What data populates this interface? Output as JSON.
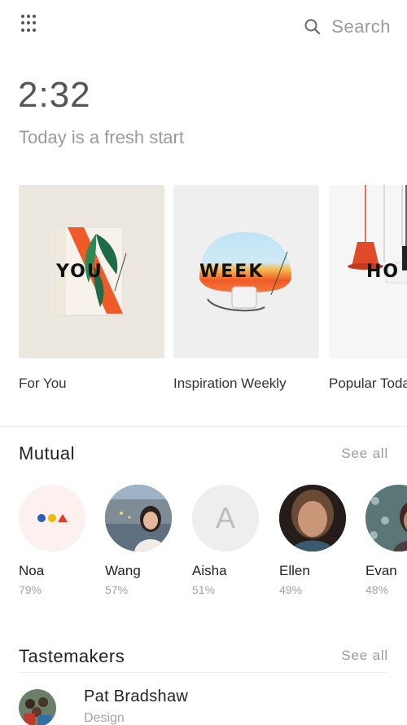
{
  "header": {
    "menu_icon": "grid-menu-icon",
    "search_icon": "search-icon",
    "search_label": "Search"
  },
  "hero": {
    "time": "2:32",
    "greeting": "Today is a fresh start"
  },
  "collections": [
    {
      "label": "For You",
      "thumb_word": "YOU",
      "bg": "#ece8df"
    },
    {
      "label": "Inspiration Weekly",
      "thumb_word": "WEEK",
      "bg": "#efefef"
    },
    {
      "label": "Popular Today",
      "thumb_word": "HO",
      "bg": "#f6f6f6"
    }
  ],
  "mutual": {
    "title": "Mutual",
    "see_all": "See all",
    "people": [
      {
        "name": "Noa",
        "pct": "79%",
        "avatar": "shapes-logo-icon"
      },
      {
        "name": "Wang",
        "pct": "57%",
        "avatar": "photo"
      },
      {
        "name": "Aisha",
        "pct": "51%",
        "avatar": "letter",
        "initial": "A"
      },
      {
        "name": "Ellen",
        "pct": "49%",
        "avatar": "photo"
      },
      {
        "name": "Evan",
        "pct": "48%",
        "avatar": "photo"
      }
    ]
  },
  "tastemakers": {
    "title": "Tastemakers",
    "see_all": "See all",
    "items": [
      {
        "name": "Pat Bradshaw",
        "subtitle": "Design"
      }
    ]
  },
  "colors": {
    "accent_orange": "#f05a28",
    "logo_blue": "#2b5cc4",
    "logo_yellow": "#f2b705",
    "logo_red": "#e63a2e",
    "text_muted": "#9a9a9a"
  }
}
